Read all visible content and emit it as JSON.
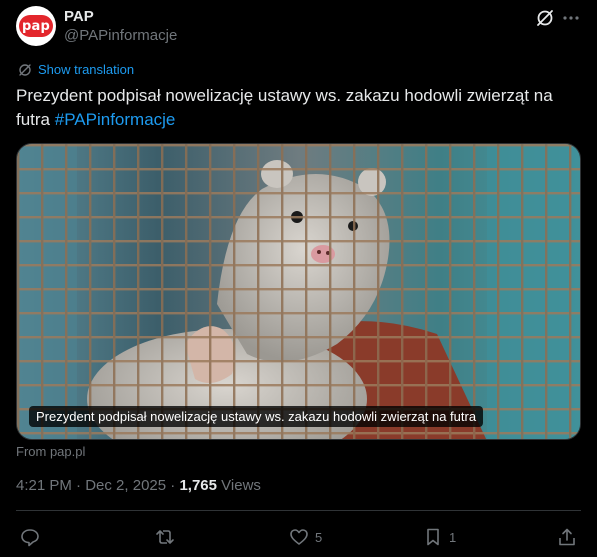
{
  "author": {
    "avatar_text": "pap",
    "name": "PAP",
    "handle": "@PAPinformacje"
  },
  "translate_label": "Show translation",
  "tweet": {
    "text": "Prezydent podpisał nowelizację ustawy ws. zakazu hodowli zwierząt na futra ",
    "hashtag": "#PAPinformacje"
  },
  "media": {
    "caption": "Prezydent podpisał nowelizację ustawy ws. zakazu hodowli zwierząt na futra",
    "source": "From pap.pl"
  },
  "meta": {
    "time": "4:21 PM",
    "separator1": " · ",
    "date": "Dec 2, 2025",
    "separator2": " · ",
    "views_count": "1,765",
    "views_label": " Views"
  },
  "actions": {
    "likes": "5",
    "bookmarks": "1"
  },
  "colors": {
    "accent": "#1d9bf0",
    "muted": "#71767b",
    "brand": "#e3262c"
  }
}
